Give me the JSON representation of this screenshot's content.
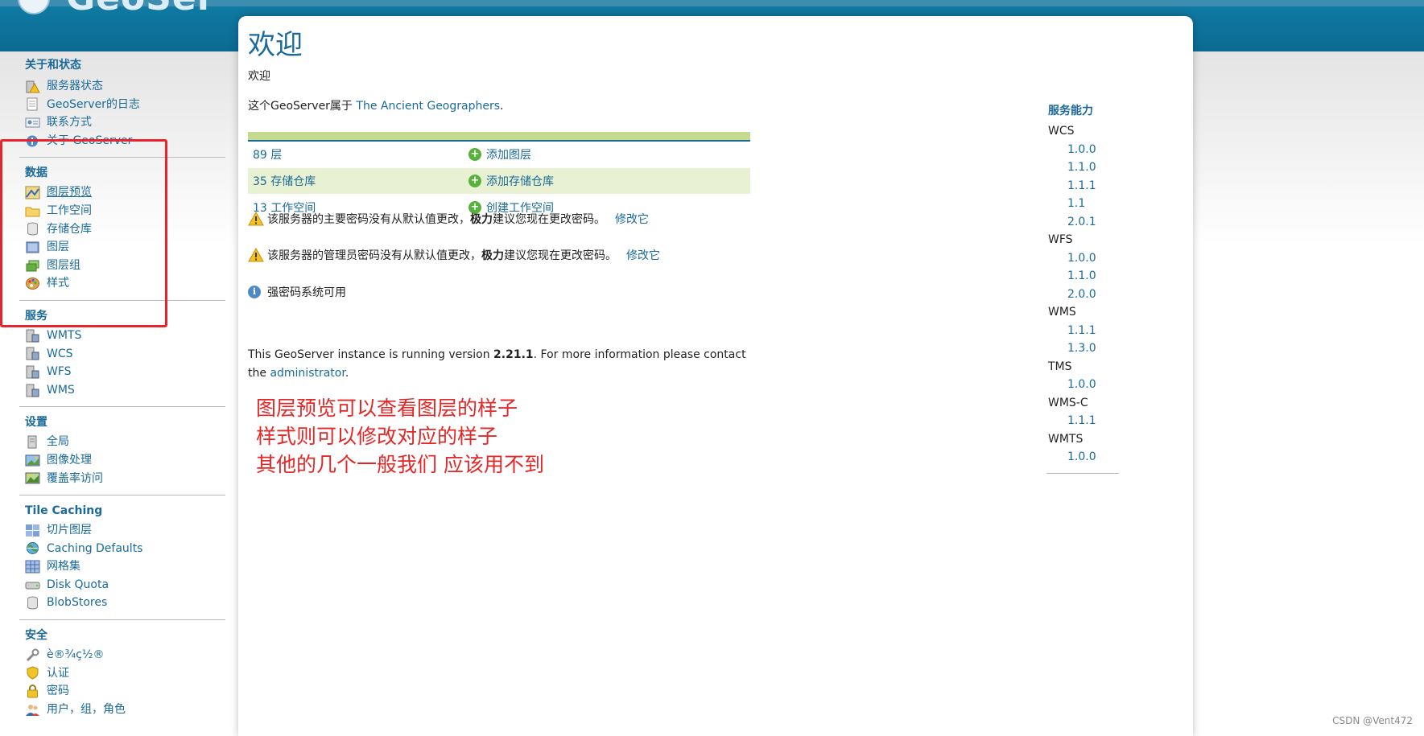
{
  "header": {
    "logo_text": "GeoServer"
  },
  "sidebar": {
    "sections": [
      {
        "title": "关于和状态",
        "items": [
          {
            "label": "服务器状态",
            "icon": "server-status-icon"
          },
          {
            "label": "GeoServer的日志",
            "icon": "log-document-icon"
          },
          {
            "label": "联系方式",
            "icon": "contact-card-icon"
          },
          {
            "label": "关于 GeoServer",
            "icon": "info-circle-icon"
          }
        ]
      },
      {
        "title": "数据",
        "items": [
          {
            "label": "图层预览",
            "icon": "layer-preview-icon"
          },
          {
            "label": "工作空间",
            "icon": "folder-icon"
          },
          {
            "label": "存储仓库",
            "icon": "database-icon"
          },
          {
            "label": "图层",
            "icon": "layer-icon"
          },
          {
            "label": "图层组",
            "icon": "layer-group-icon"
          },
          {
            "label": "样式",
            "icon": "palette-icon"
          }
        ]
      },
      {
        "title": "服务",
        "items": [
          {
            "label": "WMTS",
            "icon": "service-icon"
          },
          {
            "label": "WCS",
            "icon": "service-icon"
          },
          {
            "label": "WFS",
            "icon": "service-icon"
          },
          {
            "label": "WMS",
            "icon": "service-icon"
          }
        ]
      },
      {
        "title": "设置",
        "items": [
          {
            "label": "全局",
            "icon": "server-icon"
          },
          {
            "label": "图像处理",
            "icon": "image-processing-icon"
          },
          {
            "label": "覆盖率访问",
            "icon": "coverage-access-icon"
          }
        ]
      },
      {
        "title": "Tile Caching",
        "items": [
          {
            "label": "切片图层",
            "icon": "tile-grid-icon"
          },
          {
            "label": "Caching Defaults",
            "icon": "globe-icon"
          },
          {
            "label": "网格集",
            "icon": "grid-icon"
          },
          {
            "label": "Disk Quota",
            "icon": "disk-icon"
          },
          {
            "label": "BlobStores",
            "icon": "blob-icon"
          }
        ]
      },
      {
        "title": "安全",
        "items": [
          {
            "label": "è®¾ç½®",
            "icon": "wrench-icon"
          },
          {
            "label": "认证",
            "icon": "shield-icon"
          },
          {
            "label": "密码",
            "icon": "lock-icon"
          },
          {
            "label": "用户，组，角色",
            "icon": "users-icon"
          }
        ]
      }
    ]
  },
  "main": {
    "title": "欢迎",
    "subtitle": "欢迎",
    "owner_prefix": "这个GeoServer属于 ",
    "owner_link": "The Ancient Geographers",
    "owner_suffix": ".",
    "stats": [
      {
        "count": "89 层",
        "action": "添加图层"
      },
      {
        "count": "35 存储仓库",
        "action": "添加存储仓库"
      },
      {
        "count": "13 工作空间",
        "action": "创建工作空间"
      }
    ],
    "warnings": [
      {
        "pre": "该服务器的主要密码没有从默认值更改，",
        "bold": "极力",
        "post": "建议您现在更改密码。",
        "link": "修改它"
      },
      {
        "pre": "该服务器的管理员密码没有从默认值更改，",
        "bold": "极力",
        "post": "建议您现在更改密码。",
        "link": "修改它"
      }
    ],
    "info": "强密码系统可用",
    "version_pre": "This GeoServer instance is running version ",
    "version_num": "2.21.1",
    "version_post": ". For more information please contact the ",
    "version_link": "administrator",
    "version_end": ".",
    "annotation": [
      "图层预览可以查看图层的样子",
      "样式则可以修改对应的样子",
      "其他的几个一般我们 应该用不到"
    ]
  },
  "capabilities": {
    "title": "服务能力",
    "services": [
      {
        "name": "WCS",
        "versions": [
          "1.0.0",
          "1.1.0",
          "1.1.1",
          "1.1",
          "2.0.1"
        ]
      },
      {
        "name": "WFS",
        "versions": [
          "1.0.0",
          "1.1.0",
          "2.0.0"
        ]
      },
      {
        "name": "WMS",
        "versions": [
          "1.1.1",
          "1.3.0"
        ]
      },
      {
        "name": "TMS",
        "versions": [
          "1.0.0"
        ]
      },
      {
        "name": "WMS-C",
        "versions": [
          "1.1.1"
        ]
      },
      {
        "name": "WMTS",
        "versions": [
          "1.0.0"
        ]
      }
    ]
  },
  "watermark": "CSDN @Vent472",
  "colors": {
    "link": "#1a6a9a",
    "header": "#0f7aa3",
    "highlight": "#e8232a",
    "annotation": "#e42727"
  }
}
